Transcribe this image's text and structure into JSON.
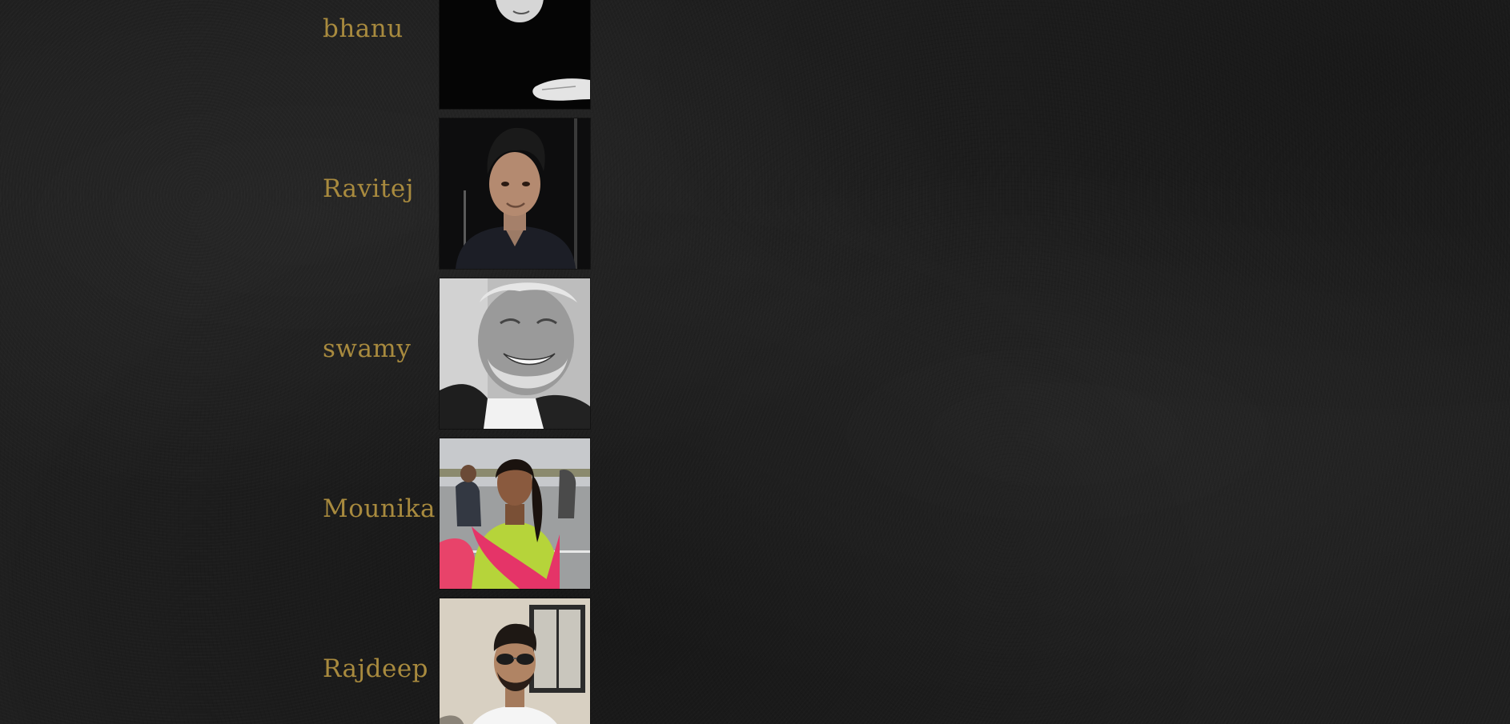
{
  "people": [
    {
      "name": "bhanu"
    },
    {
      "name": "Ravitej"
    },
    {
      "name": "swamy"
    },
    {
      "name": "Mounika"
    },
    {
      "name": "Rajdeep"
    }
  ],
  "colors": {
    "background": "#1f1f1f",
    "name_text": "#a88a3e"
  }
}
